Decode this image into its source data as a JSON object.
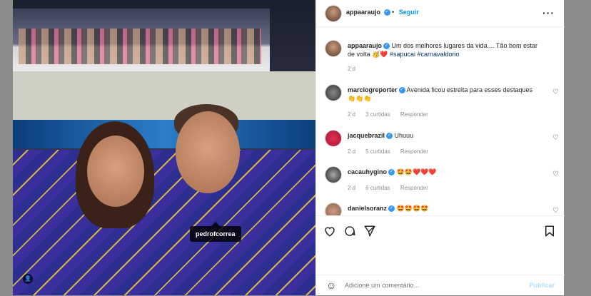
{
  "post": {
    "author": "appaaraujo",
    "follow_label": "Seguir",
    "caption_text": "Um dos melhores lugares da vida.... Tão bom estar de volta 🥳❤️",
    "hashtags": "#sapucai #carnavaldorio",
    "time": "2 d",
    "photo_tag": "pedrofcorrea"
  },
  "comments": [
    {
      "user": "marciogreporter",
      "text": "Avenida ficou estreita para esses destaques 👏👏👏",
      "time": "2 d",
      "likes": "3 curtidas",
      "reply": "Responder"
    },
    {
      "user": "jacquebrazil",
      "text": "Uhuuu",
      "time": "2 d",
      "likes": "5 curtidas",
      "reply": "Responder"
    },
    {
      "user": "cacauhygino",
      "text": "🤩🤩❤️❤️❤️",
      "time": "2 d",
      "likes": "6 curtidas",
      "reply": "Responder"
    },
    {
      "user": "danielsoranz",
      "text": "🤩🤩🤩🤩",
      "time": "",
      "likes": "",
      "reply": ""
    }
  ],
  "add_comment": {
    "placeholder": "Adicione um comentário...",
    "publish_label": "Publicar"
  },
  "icons": {
    "more": "more-horizontal-icon",
    "like": "heart-icon",
    "comment": "comment-icon",
    "share": "share-icon",
    "save": "bookmark-icon",
    "emoji": "emoji-icon"
  },
  "colors": {
    "link": "#0095f6",
    "verified": "#3897f0",
    "hashtag": "#00376b",
    "muted": "#8e8e8e"
  }
}
